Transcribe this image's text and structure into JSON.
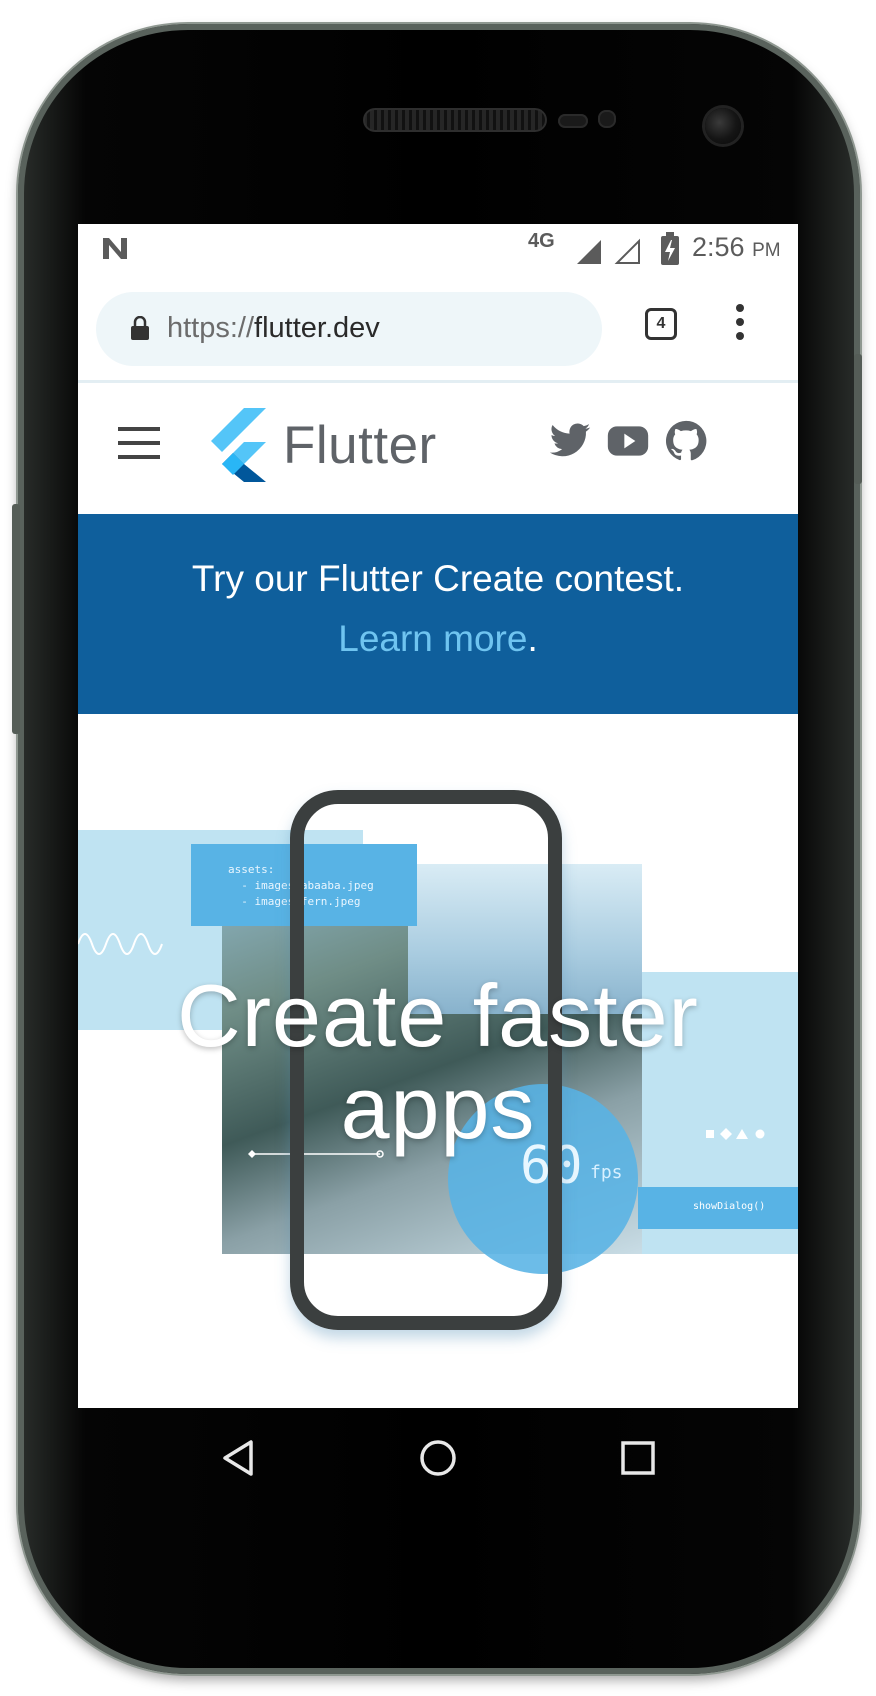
{
  "status_bar": {
    "notification_icon": "n-icon",
    "network": "4G",
    "time": "2:56",
    "ampm": "PM",
    "icons": [
      "signal-icon",
      "signal-empty-icon",
      "battery-charging-icon"
    ]
  },
  "browser": {
    "url_scheme": "https://",
    "url_host": "flutter.dev",
    "tab_count": "4",
    "icons": [
      "lock-icon",
      "overflow-menu-icon"
    ]
  },
  "site_header": {
    "brand": "Flutter",
    "icons": [
      "hamburger-menu-icon",
      "flutter-logo-icon",
      "twitter-icon",
      "youtube-icon",
      "github-icon"
    ]
  },
  "banner": {
    "line1": "Try our Flutter Create contest.",
    "link_text": "Learn more",
    "link_suffix": "."
  },
  "hero": {
    "title_line1": "Create faster",
    "title_line2": "apps",
    "code_snippet": "assets:\n  - images/abaaba.jpeg\n  - images/fern.jpeg",
    "fps_value": "60",
    "fps_unit": "fps",
    "dialog_code": "showDialog()"
  },
  "navbar": {
    "icons": [
      "back-icon",
      "home-icon",
      "recents-icon"
    ]
  },
  "colors": {
    "banner_bg": "#0f5f9c",
    "link": "#6fc4f0",
    "flutter_light": "#54c5f8",
    "flutter_dark": "#01579b",
    "hero_light_blue": "#bfe3f2",
    "hero_mid_blue": "#58b3e5"
  }
}
